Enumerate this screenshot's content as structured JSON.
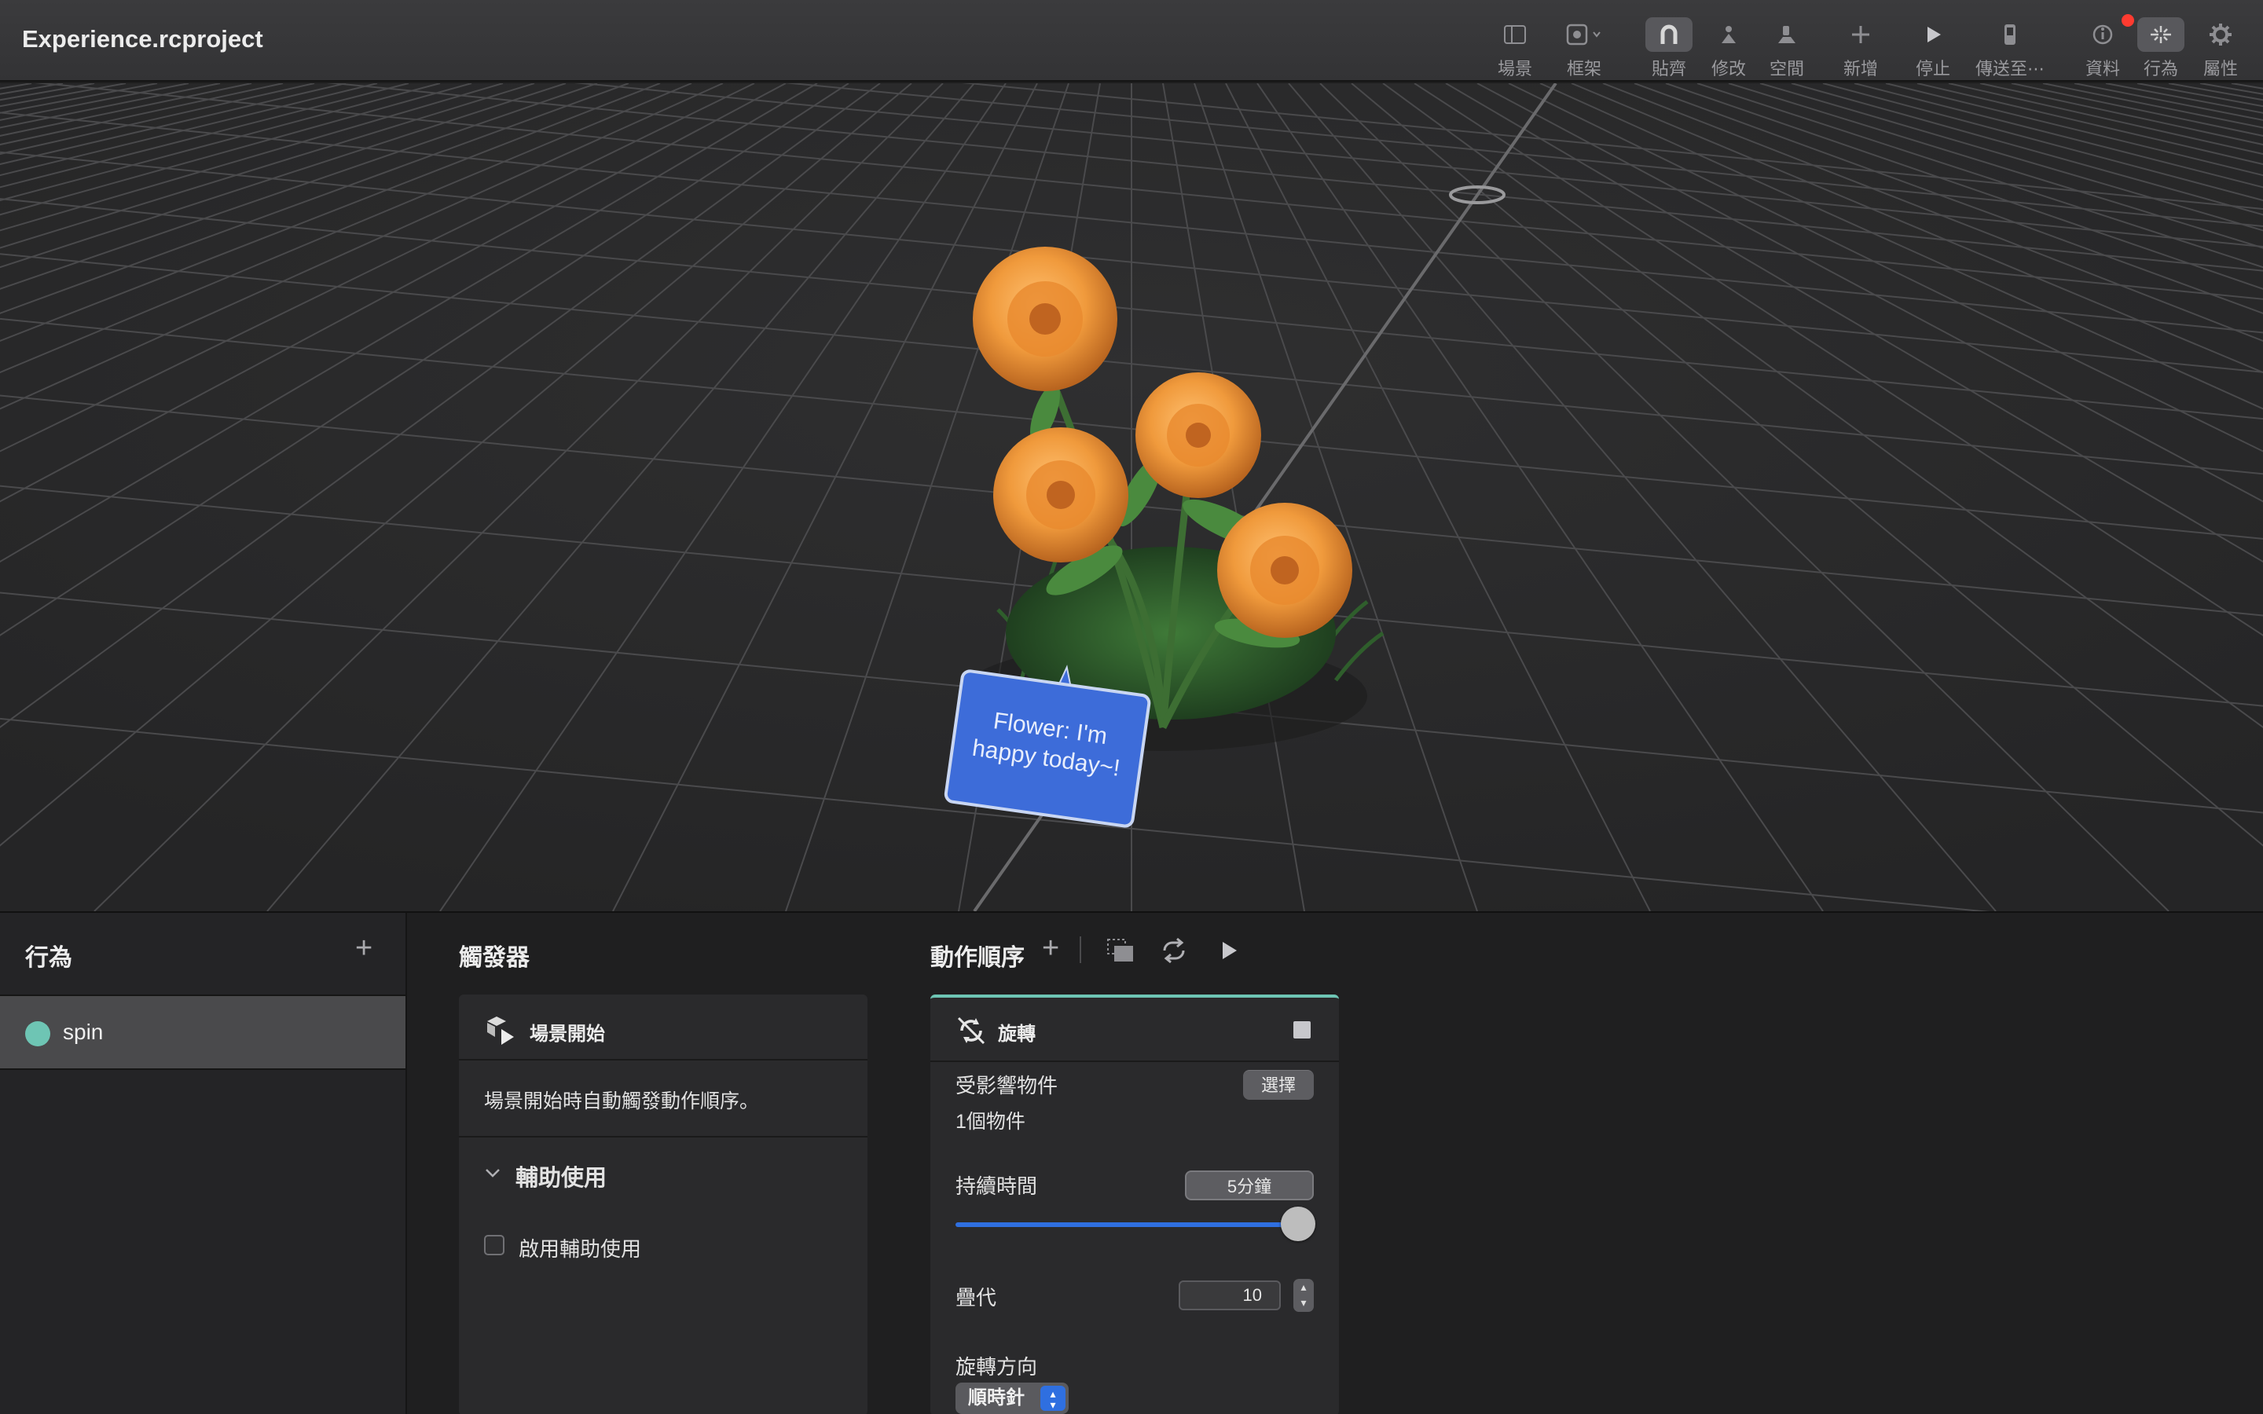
{
  "window": {
    "title": "Experience.rcproject"
  },
  "toolbar": {
    "items": [
      {
        "label": "場景",
        "icon": "sidebar-icon"
      },
      {
        "label": "框架",
        "icon": "frame-icon"
      },
      {
        "label": "貼齊",
        "icon": "magnet-icon",
        "active": true
      },
      {
        "label": "修改",
        "icon": "modify-icon"
      },
      {
        "label": "空間",
        "icon": "space-icon"
      },
      {
        "label": "新增",
        "icon": "plus-icon"
      },
      {
        "label": "停止",
        "icon": "play-icon"
      },
      {
        "label": "傳送至⋯",
        "icon": "send-device-icon"
      },
      {
        "label": "資料",
        "icon": "info-icon",
        "badge": true
      },
      {
        "label": "行為",
        "icon": "behavior-icon",
        "active": true
      },
      {
        "label": "屬性",
        "icon": "gear-icon"
      }
    ]
  },
  "viewport": {
    "sign_text_line1": "Flower: I'm",
    "sign_text_line2": "happy today~!"
  },
  "behaviors": {
    "title": "行為",
    "add_label": "+",
    "items": [
      {
        "label": "spin",
        "color": "#6ec5b4"
      }
    ]
  },
  "triggers": {
    "title": "觸發器",
    "card_title": "場景開始",
    "description": "場景開始時自動觸發動作順序。",
    "accessibility_section": "輔助使用",
    "enable_accessibility": "啟用輔助使用"
  },
  "action_sequence": {
    "title": "動作順序",
    "add_label": "+",
    "card_title": "旋轉",
    "affected_objects_label": "受影響物件",
    "select_label": "選擇",
    "affected_objects_count": "1個物件",
    "duration_label": "持續時間",
    "duration_value": "5分鐘",
    "duration_fill": 1.0,
    "iterations_label": "疊代",
    "iterations_value": "10",
    "direction_label": "旋轉方向",
    "direction_value": "順時針"
  },
  "colors": {
    "accent": "#2f6fe0",
    "teal": "#6ec5b4",
    "sign_blue": "#3d6cd9"
  }
}
